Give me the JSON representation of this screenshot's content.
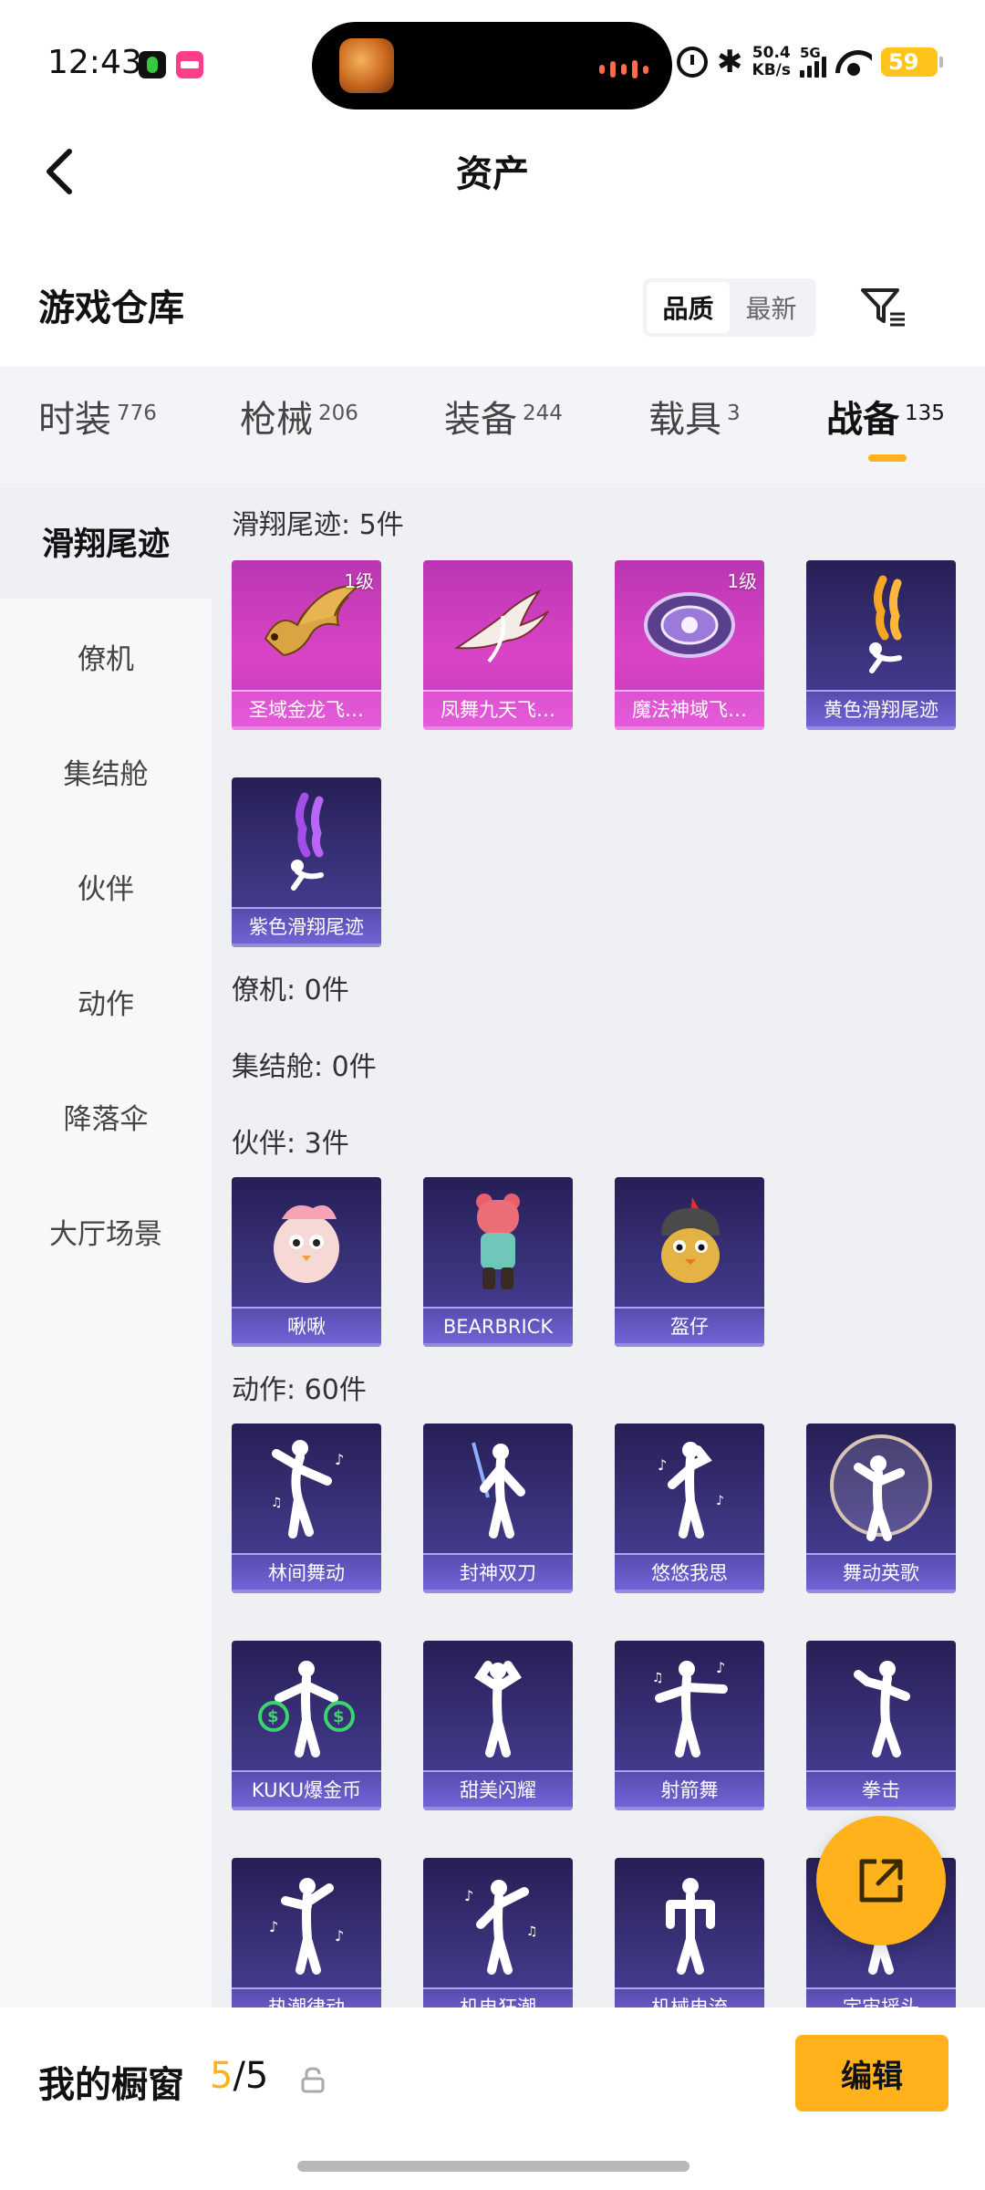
{
  "status_bar": {
    "time": "12:43",
    "net_speed_value": "50.4",
    "net_speed_unit": "KB/s",
    "network": "5G",
    "battery": "59"
  },
  "header": {
    "title": "资产"
  },
  "warehouse": {
    "title": "游戏仓库",
    "sort_options": [
      "品质",
      "最新"
    ],
    "sort_selected": "品质"
  },
  "tabs": [
    {
      "label": "时装",
      "count": "776"
    },
    {
      "label": "枪械",
      "count": "206"
    },
    {
      "label": "装备",
      "count": "244"
    },
    {
      "label": "载具",
      "count": "3"
    },
    {
      "label": "战备",
      "count": "135"
    }
  ],
  "active_tab": "战备",
  "sidebar": {
    "items": [
      "滑翔尾迹",
      "僚机",
      "集结舱",
      "伙伴",
      "动作",
      "降落伞",
      "大厅场景"
    ],
    "active": "滑翔尾迹"
  },
  "groups": {
    "glide": {
      "title": "滑翔尾迹: 5件",
      "items": [
        {
          "name": "圣域金龙飞…",
          "level": "1级",
          "icon": "dragon"
        },
        {
          "name": "凤舞九天飞…",
          "level": "",
          "icon": "phoenix"
        },
        {
          "name": "魔法神域飞…",
          "level": "1级",
          "icon": "magic-orb"
        },
        {
          "name": "黄色滑翔尾迹",
          "level": "",
          "icon": "yellow-smoke"
        },
        {
          "name": "紫色滑翔尾迹",
          "level": "",
          "icon": "purple-smoke"
        }
      ]
    },
    "wingman": {
      "title": "僚机: 0件"
    },
    "capsule": {
      "title": "集结舱: 0件"
    },
    "partner": {
      "title": "伙伴: 3件",
      "items": [
        {
          "name": "啾啾",
          "icon": "chick-pet"
        },
        {
          "name": "BEARBRICK",
          "icon": "bear-figure"
        },
        {
          "name": "盔仔",
          "icon": "helmet-chick"
        }
      ]
    },
    "emote": {
      "title": "动作: 60件",
      "items": [
        {
          "name": "林间舞动",
          "icon": "dance-pose"
        },
        {
          "name": "封神双刀",
          "icon": "blade-pose"
        },
        {
          "name": "悠悠我思",
          "icon": "think-pose"
        },
        {
          "name": "舞动英歌",
          "icon": "bubble-pose"
        },
        {
          "name": "KUKU爆金币",
          "icon": "money-bag-pose"
        },
        {
          "name": "甜美闪耀",
          "icon": "shine-pose"
        },
        {
          "name": "射箭舞",
          "icon": "archer-pose"
        },
        {
          "name": "拳击",
          "icon": "boxing-pose"
        },
        {
          "name": "热潮律动",
          "icon": "groove-pose"
        },
        {
          "name": "机电狂潮",
          "icon": "disco-pose"
        },
        {
          "name": "机械电流",
          "icon": "robot-pose"
        },
        {
          "name": "宇宙摇头",
          "icon": "headbang-pose"
        }
      ]
    }
  },
  "bottom": {
    "showcase_label": "我的橱窗",
    "showcase_current": "5",
    "showcase_total": "/5",
    "edit_label": "编辑"
  },
  "colors": {
    "accent": "#ffb21c",
    "legendary_card": "#c93cbd",
    "epic_card": "#3d3580"
  }
}
